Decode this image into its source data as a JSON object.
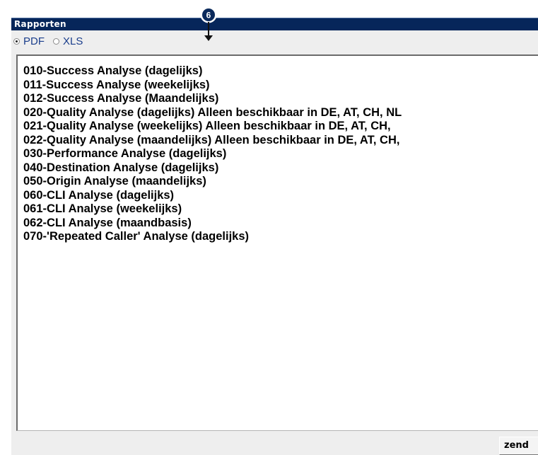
{
  "header": {
    "title": "Rapporten"
  },
  "format_options": [
    {
      "label": "PDF",
      "checked": true
    },
    {
      "label": "XLS",
      "checked": false
    }
  ],
  "reports": [
    "010-Success Analyse (dagelijks)",
    "011-Success Analyse (weekelijks)",
    "012-Success Analyse (Maandelijks)",
    "020-Quality Analyse (dagelijks) Alleen beschikbaar in DE, AT, CH, NL",
    "021-Quality Analyse (weekelijks) Alleen beschikbaar in DE, AT, CH,",
    "022-Quality Analyse (maandelijks) Alleen beschikbaar in DE, AT, CH,",
    "030-Performance Analyse (dagelijks)",
    "040-Destination Analyse (dagelijks)",
    "050-Origin Analyse (maandelijks)",
    "060-CLI Analyse (dagelijks)",
    "061-CLI Analyse (weekelijks)",
    "062-CLI Analyse (maandbasis)",
    "070-'Repeated Caller' Analyse (dagelijks)"
  ],
  "submit_label": "zend",
  "callout": {
    "number": "6",
    "icon": "arrow-down-icon"
  },
  "colors": {
    "header_bg": "#06265a",
    "radio_label": "#1a3e8c",
    "panel_bg": "#eeeeee"
  }
}
